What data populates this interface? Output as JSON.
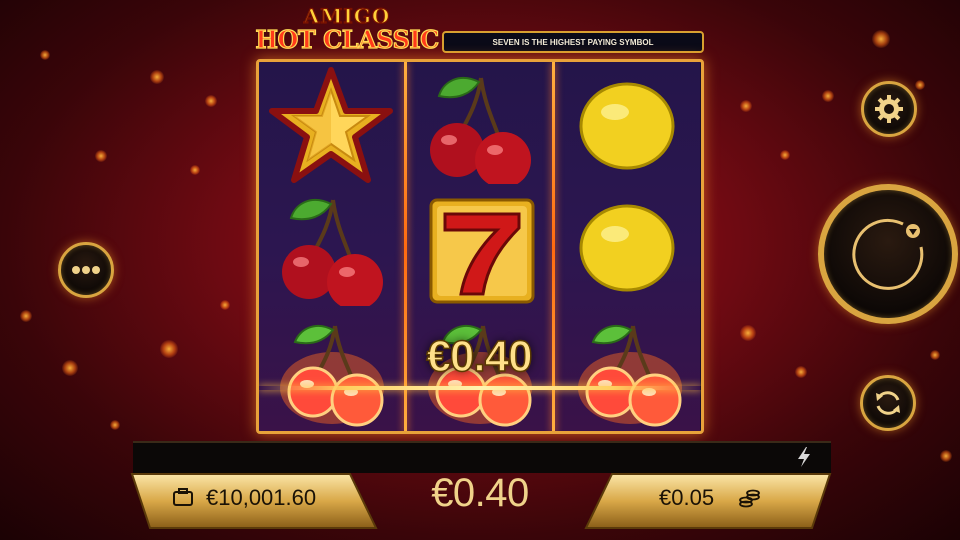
{
  "logo": {
    "line1": "AMIGO",
    "line2": "HOT CLASSIC"
  },
  "info_bar": {
    "message": "SEVEN IS THE HIGHEST PAYING SYMBOL"
  },
  "reels": {
    "reel1": [
      "star",
      "cherry",
      "cherry-fire"
    ],
    "reel2": [
      "cherry",
      "seven",
      "cherry-fire"
    ],
    "reel3": [
      "lemon",
      "lemon",
      "cherry-fire"
    ]
  },
  "win_popup": {
    "amount": "€0.40"
  },
  "footer": {
    "balance": "€10,001.60",
    "win": "€0.40",
    "bet": "€0.05"
  },
  "icons": {
    "menu": "ellipsis-icon",
    "settings": "gear-icon",
    "spin": "spin-arrow-icon",
    "autoplay": "autoplay-icon",
    "turbo": "lightning-bolt-icon",
    "balance": "wallet-icon",
    "bet": "coins-icon"
  },
  "colors": {
    "accent_gold": "#d9a540",
    "background": "#8a0c14",
    "win_text": "#ffe08a"
  }
}
